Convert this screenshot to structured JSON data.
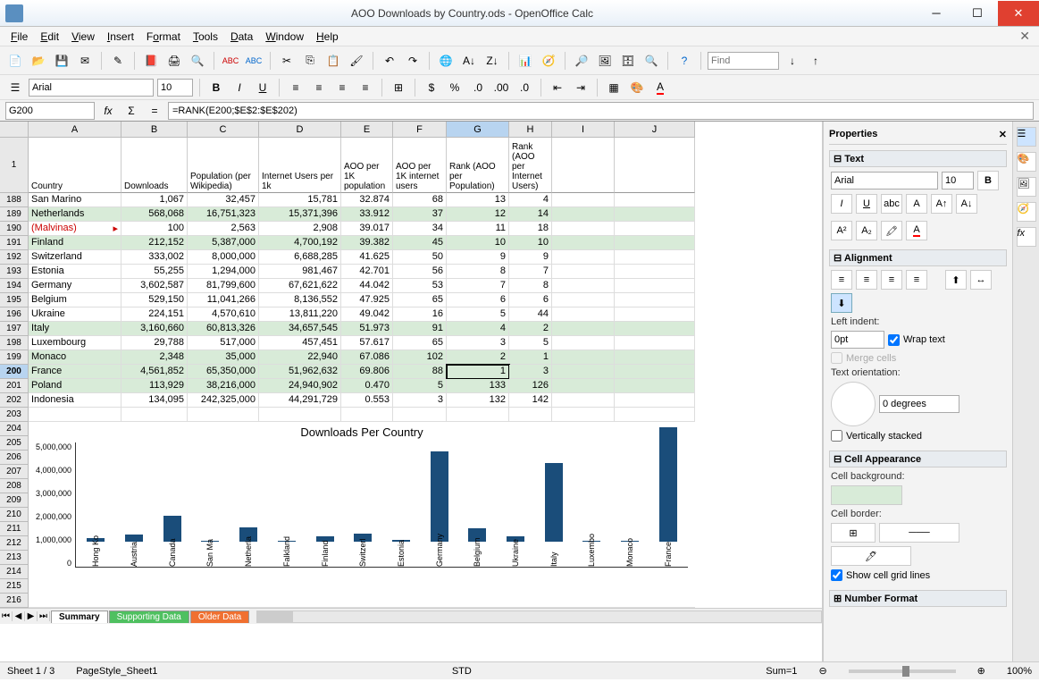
{
  "window": {
    "title": "AOO Downloads by Country.ods - OpenOffice Calc"
  },
  "menu": [
    "File",
    "Edit",
    "View",
    "Insert",
    "Format",
    "Tools",
    "Data",
    "Window",
    "Help"
  ],
  "find_placeholder": "Find",
  "font": {
    "name": "Arial",
    "size": "10"
  },
  "namebox": "G200",
  "formula": "=RANK(E200;$E$2:$E$202)",
  "columns": [
    "A",
    "B",
    "C",
    "D",
    "E",
    "F",
    "G",
    "H",
    "I",
    "J"
  ],
  "header_row": "1",
  "headers": [
    "Country",
    "Downloads",
    "Population (per Wikipedia)",
    "Internet Users per 1k",
    "AOO per 1K population",
    "AOO per 1K internet users",
    "Rank (AOO per Population)",
    "Rank (AOO per Internet Users)",
    "",
    ""
  ],
  "rows": [
    {
      "n": "188",
      "green": false,
      "c": [
        "San Marino",
        "1,067",
        "32,457",
        "15,781",
        "32.874",
        "68",
        "13",
        "4",
        "",
        ""
      ]
    },
    {
      "n": "189",
      "green": true,
      "c": [
        "Netherlands",
        "568,068",
        "16,751,323",
        "15,371,396",
        "33.912",
        "37",
        "12",
        "14",
        "",
        ""
      ]
    },
    {
      "n": "190",
      "green": false,
      "c": [
        "(Malvinas)",
        "100",
        "2,563",
        "2,908",
        "39.017",
        "34",
        "11",
        "18",
        "",
        ""
      ],
      "red": true,
      "mark": true
    },
    {
      "n": "191",
      "green": true,
      "c": [
        "Finland",
        "212,152",
        "5,387,000",
        "4,700,192",
        "39.382",
        "45",
        "10",
        "10",
        "",
        ""
      ]
    },
    {
      "n": "192",
      "green": false,
      "c": [
        "Switzerland",
        "333,002",
        "8,000,000",
        "6,688,285",
        "41.625",
        "50",
        "9",
        "9",
        "",
        ""
      ]
    },
    {
      "n": "193",
      "green": false,
      "c": [
        "Estonia",
        "55,255",
        "1,294,000",
        "981,467",
        "42.701",
        "56",
        "8",
        "7",
        "",
        ""
      ]
    },
    {
      "n": "194",
      "green": false,
      "c": [
        "Germany",
        "3,602,587",
        "81,799,600",
        "67,621,622",
        "44.042",
        "53",
        "7",
        "8",
        "",
        ""
      ]
    },
    {
      "n": "195",
      "green": false,
      "c": [
        "Belgium",
        "529,150",
        "11,041,266",
        "8,136,552",
        "47.925",
        "65",
        "6",
        "6",
        "",
        ""
      ]
    },
    {
      "n": "196",
      "green": false,
      "c": [
        "Ukraine",
        "224,151",
        "4,570,610",
        "13,811,220",
        "49.042",
        "16",
        "5",
        "44",
        "",
        ""
      ]
    },
    {
      "n": "197",
      "green": true,
      "c": [
        "Italy",
        "3,160,660",
        "60,813,326",
        "34,657,545",
        "51.973",
        "91",
        "4",
        "2",
        "",
        ""
      ]
    },
    {
      "n": "198",
      "green": false,
      "c": [
        "Luxembourg",
        "29,788",
        "517,000",
        "457,451",
        "57.617",
        "65",
        "3",
        "5",
        "",
        ""
      ]
    },
    {
      "n": "199",
      "green": true,
      "c": [
        "Monaco",
        "2,348",
        "35,000",
        "22,940",
        "67.086",
        "102",
        "2",
        "1",
        "",
        ""
      ]
    },
    {
      "n": "200",
      "green": true,
      "c": [
        "France",
        "4,561,852",
        "65,350,000",
        "51,962,632",
        "69.806",
        "88",
        "1",
        "3",
        "",
        ""
      ],
      "cursor": 6
    },
    {
      "n": "201",
      "green": true,
      "c": [
        "Poland",
        "113,929",
        "38,216,000",
        "24,940,902",
        "0.470",
        "5",
        "133",
        "126",
        "",
        ""
      ]
    },
    {
      "n": "202",
      "green": false,
      "c": [
        "Indonesia",
        "134,095",
        "242,325,000",
        "44,291,729",
        "0.553",
        "3",
        "132",
        "142",
        "",
        ""
      ]
    }
  ],
  "empty_rows": [
    "203",
    "204",
    "205",
    "206",
    "207",
    "208",
    "209",
    "210",
    "211",
    "212",
    "213",
    "214",
    "215",
    "216"
  ],
  "chart_data": {
    "type": "bar",
    "title": "Downloads Per Country",
    "categories": [
      "Hong Ko",
      "Austria",
      "Canada",
      "San Ma",
      "Netherla",
      "Falkland",
      "Finland",
      "Switzerl",
      "Estonia",
      "Germany",
      "Belgium",
      "Ukraine",
      "Italy",
      "Luxembo",
      "Monaco",
      "France"
    ],
    "values": [
      153000,
      271000,
      1036000,
      1067,
      568068,
      100,
      212152,
      333002,
      55255,
      3602587,
      529150,
      224151,
      3160660,
      29788,
      2348,
      4561852
    ],
    "ylim": [
      0,
      5000000
    ],
    "yticks": [
      "5,000,000",
      "4,000,000",
      "3,000,000",
      "2,000,000",
      "1,000,000",
      "0"
    ],
    "xlabel": "",
    "ylabel": ""
  },
  "sheets": [
    "Summary",
    "Supporting Data",
    "Older Data"
  ],
  "status": {
    "sheet": "Sheet 1 / 3",
    "style": "PageStyle_Sheet1",
    "mode": "STD",
    "sum": "Sum=1",
    "zoom": "100%"
  },
  "props": {
    "title": "Properties",
    "text_section": "Text",
    "font": "Arial",
    "size": "10",
    "align_section": "Alignment",
    "left_indent": "Left indent:",
    "indent_val": "0pt",
    "wrap": "Wrap text",
    "merge": "Merge cells",
    "orient": "Text orientation:",
    "deg": "0 degrees",
    "vstack": "Vertically stacked",
    "cellapp": "Cell Appearance",
    "cellbg": "Cell background:",
    "cellborder": "Cell border:",
    "gridlines": "Show cell grid lines",
    "numfmt": "Number Format"
  }
}
